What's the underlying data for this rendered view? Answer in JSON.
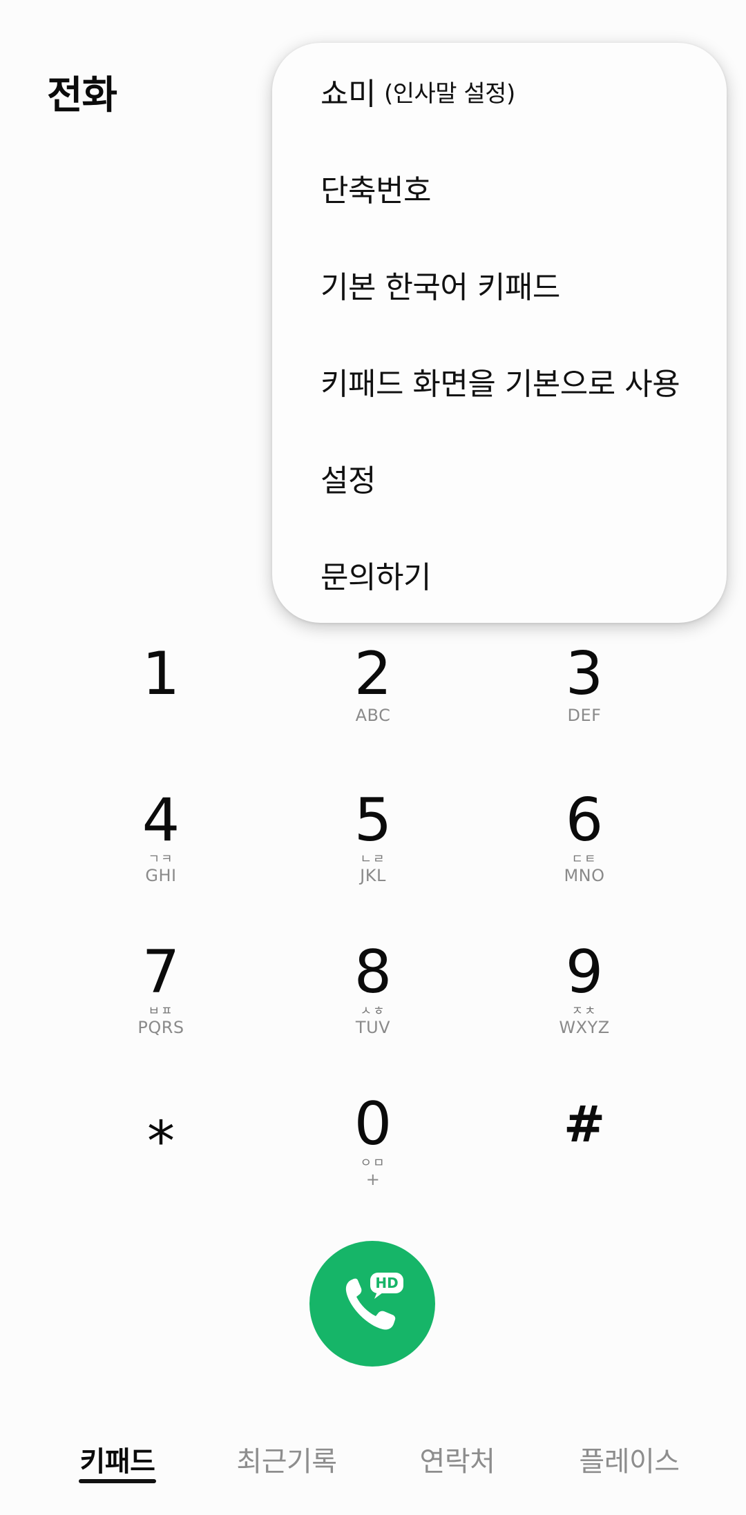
{
  "header": {
    "title": "전화"
  },
  "menu": {
    "items": [
      {
        "label": "쇼미",
        "sub": "(인사말 설정)"
      },
      {
        "label": "단축번호"
      },
      {
        "label": "기본 한국어 키패드"
      },
      {
        "label": "키패드 화면을 기본으로 사용"
      },
      {
        "label": "설정"
      },
      {
        "label": "문의하기"
      }
    ]
  },
  "dialpad": {
    "keys": [
      {
        "digit": "1",
        "kor": "",
        "eng": ""
      },
      {
        "digit": "2",
        "kor": "",
        "eng": "ABC"
      },
      {
        "digit": "3",
        "kor": "",
        "eng": "DEF"
      },
      {
        "digit": "4",
        "kor": "ㄱㅋ",
        "eng": "GHI"
      },
      {
        "digit": "5",
        "kor": "ㄴㄹ",
        "eng": "JKL"
      },
      {
        "digit": "6",
        "kor": "ㄷㅌ",
        "eng": "MNO"
      },
      {
        "digit": "7",
        "kor": "ㅂㅍ",
        "eng": "PQRS"
      },
      {
        "digit": "8",
        "kor": "ㅅㅎ",
        "eng": "TUV"
      },
      {
        "digit": "9",
        "kor": "ㅈㅊ",
        "eng": "WXYZ"
      },
      {
        "digit": "⁎",
        "kor": "",
        "eng": ""
      },
      {
        "digit": "0",
        "kor": "ㅇㅁ",
        "eng": "+"
      },
      {
        "digit": "#",
        "kor": "",
        "eng": ""
      }
    ]
  },
  "call": {
    "badge": "HD",
    "color": "#16b568"
  },
  "tabs": [
    {
      "label": "키패드",
      "active": true
    },
    {
      "label": "최근기록",
      "active": false
    },
    {
      "label": "연락처",
      "active": false
    },
    {
      "label": "플레이스",
      "active": false
    }
  ]
}
